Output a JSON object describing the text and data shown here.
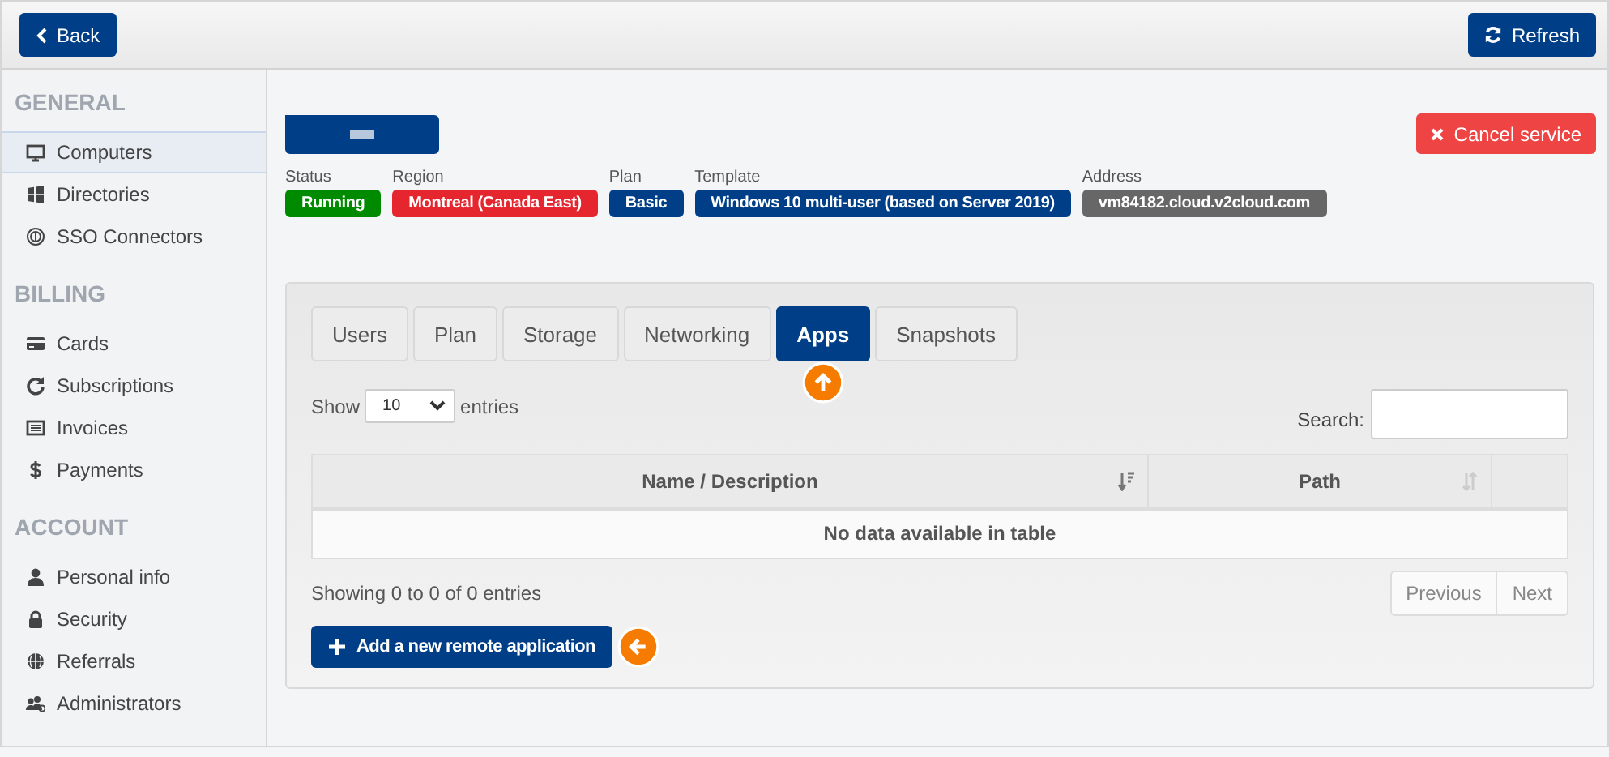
{
  "toolbar": {
    "back_button": "Back",
    "refresh_button": "Refresh"
  },
  "sidebar": {
    "sections": [
      {
        "heading": "GENERAL",
        "items": [
          {
            "label": "Computers",
            "selected": true
          },
          {
            "label": "Directories",
            "selected": false
          },
          {
            "label": "SSO Connectors",
            "selected": false
          }
        ]
      },
      {
        "heading": "BILLING",
        "items": [
          {
            "label": "Cards",
            "selected": false
          },
          {
            "label": "Subscriptions",
            "selected": false
          },
          {
            "label": "Invoices",
            "selected": false
          },
          {
            "label": "Payments",
            "selected": false
          }
        ]
      },
      {
        "heading": "ACCOUNT",
        "items": [
          {
            "label": "Personal info",
            "selected": false
          },
          {
            "label": "Security",
            "selected": false
          },
          {
            "label": "Referrals",
            "selected": false
          },
          {
            "label": "Administrators",
            "selected": false
          }
        ]
      }
    ]
  },
  "service": {
    "cancel_button": "Cancel service",
    "details": [
      {
        "label": "Status",
        "value": "Running",
        "color": "#008a00"
      },
      {
        "label": "Region",
        "value": "Montreal (Canada East)",
        "color": "#e5262e"
      },
      {
        "label": "Plan",
        "value": "Basic",
        "color": "#003f87"
      },
      {
        "label": "Template",
        "value": "Windows 10 multi-user (based on Server 2019)",
        "color": "#003f87"
      },
      {
        "label": "Address",
        "value": "vm84182.cloud.v2cloud.com",
        "color": "#676767"
      }
    ]
  },
  "tabs": [
    {
      "label": "Users",
      "selected": false
    },
    {
      "label": "Plan",
      "selected": false
    },
    {
      "label": "Storage",
      "selected": false
    },
    {
      "label": "Networking",
      "selected": false
    },
    {
      "label": "Apps",
      "selected": true
    },
    {
      "label": "Snapshots",
      "selected": false
    }
  ],
  "table_controls": {
    "show_label": "Show",
    "page_size": "10",
    "entries_label": "entries",
    "search_label": "Search:"
  },
  "table": {
    "columns": [
      {
        "label": "Name / Description",
        "sorted": true
      },
      {
        "label": "Path",
        "sorted": false
      }
    ],
    "empty_message": "No data available in table"
  },
  "info": "Showing 0 to 0 of 0 entries",
  "pagination": [
    {
      "label": "Previous",
      "disabled": true
    },
    {
      "label": "Next",
      "disabled": true
    }
  ],
  "add_button": "Add a new remote application"
}
